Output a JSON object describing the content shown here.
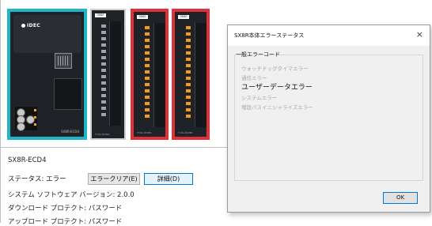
{
  "hardware": {
    "cpu_logo": "IDEC",
    "cpu_label": "SX8R-ECD4",
    "module_header": "0000",
    "module_foot": "FC8A-N08B1"
  },
  "info": {
    "model": "SX8R-ECD4",
    "status_label": "ステータス: エラー",
    "error_clear_button": "エラークリア(E)",
    "details_button": "詳細(D)",
    "firmware": "システム ソフトウェア バージョン: 2.0.0",
    "download_protect": "ダウンロード プロテクト: パスワード",
    "upload_protect": "アップロード プロテクト: パスワード"
  },
  "dialog": {
    "title": "SX8R本体エラーステータス",
    "close_glyph": "×",
    "group_title": "一般エラーコード",
    "errors": [
      {
        "label": "ウォッチドッグタイマエラー",
        "active": false
      },
      {
        "label": "通信エラー",
        "active": false
      },
      {
        "label": "ユーザーデータエラー",
        "active": true
      },
      {
        "label": "システムエラー",
        "active": false
      },
      {
        "label": "増設バスイニシャライズエラー",
        "active": false
      }
    ],
    "ok_button": "OK"
  },
  "colors": {
    "cpu_highlight": "#1fb6c8",
    "error_highlight": "#e0303a",
    "module_body": "#1f2226",
    "io_led": "#f39a1c"
  }
}
